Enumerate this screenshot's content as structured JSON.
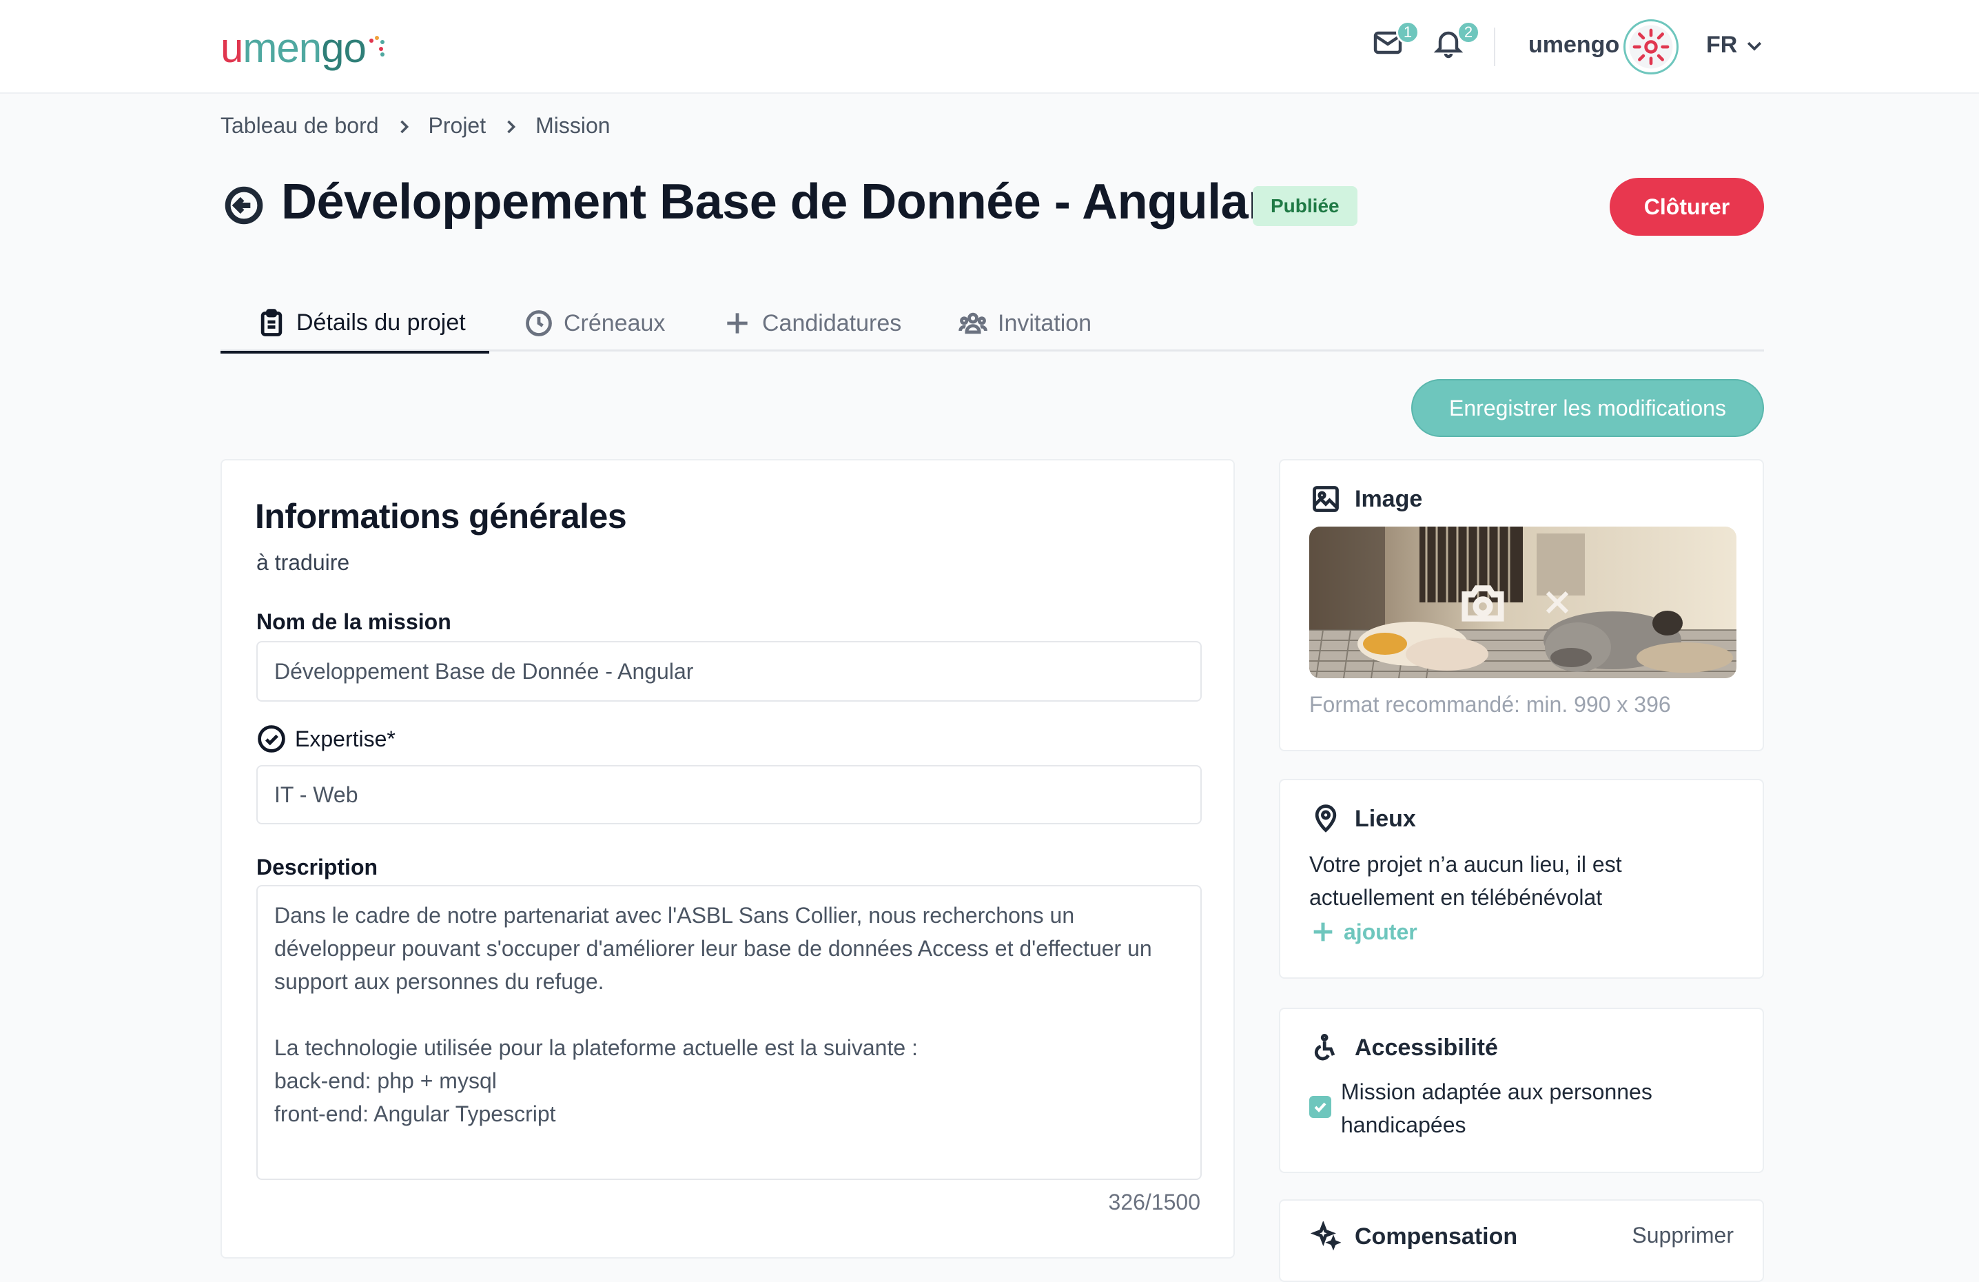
{
  "header": {
    "logo_u": "u",
    "logo_rest": "men",
    "logo_g": "go",
    "messages_count": "1",
    "notifications_count": "2",
    "user_name": "umengo",
    "language": "FR"
  },
  "breadcrumb": [
    "Tableau de bord",
    "Projet",
    "Mission"
  ],
  "page": {
    "title": "Développement Base de Donnée - Angular",
    "status": "Publiée",
    "close_label": "Clôturer",
    "save_label": "Enregistrer les modifications"
  },
  "tabs": [
    {
      "label": "Détails du projet",
      "icon": "clipboard-icon"
    },
    {
      "label": "Créneaux",
      "icon": "clock-icon"
    },
    {
      "label": "Candidatures",
      "icon": "plus-icon"
    },
    {
      "label": "Invitation",
      "icon": "users-icon"
    }
  ],
  "general": {
    "title": "Informations générales",
    "subtitle": "à traduire",
    "mission_name_label": "Nom de la mission",
    "mission_name_value": "Développement Base de Donnée - Angular",
    "expertise_label": "Expertise*",
    "expertise_value": "IT - Web",
    "description_label": "Description",
    "description_value": "Dans le cadre de notre partenariat avec l'ASBL Sans Collier, nous recherchons un développeur pouvant s'occuper d'améliorer leur base de données Access et d'effectuer un support aux personnes du refuge.\n\nLa technologie utilisée pour la plateforme actuelle est la suivante :\nback-end: php + mysql\nfront-end: Angular Typescript",
    "description_counter": "326/1500"
  },
  "image_card": {
    "title": "Image",
    "hint": "Format recommandé: min. 990 x 396"
  },
  "places_card": {
    "title": "Lieux",
    "text": "Votre projet n’a aucun lieu, il est actuellement en télébénévolat",
    "add_label": "ajouter"
  },
  "accessibility_card": {
    "title": "Accessibilité",
    "checkbox_label": "Mission adaptée aux personnes handicapées",
    "checked": true
  },
  "compensation_card": {
    "title": "Compensation",
    "delete_label": "Supprimer"
  },
  "colors": {
    "accent": "#6ec6bd",
    "danger": "#e8374f",
    "status_bg": "#d1f3df",
    "status_text": "#1f7a45"
  }
}
